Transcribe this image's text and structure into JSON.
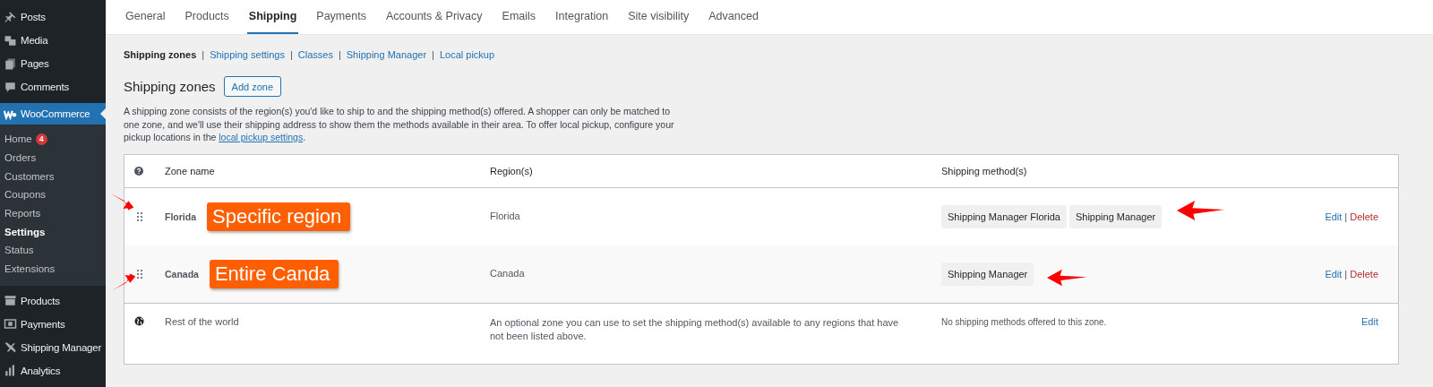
{
  "sidebar": {
    "items": [
      {
        "label": "Posts",
        "selected": false
      },
      {
        "label": "Media",
        "selected": false
      },
      {
        "label": "Pages",
        "selected": false
      },
      {
        "label": "Comments",
        "selected": false
      },
      {
        "label": "WooCommerce",
        "selected": true,
        "children": [
          {
            "label": "Home",
            "badge": "4",
            "selected": false
          },
          {
            "label": "Orders",
            "selected": false
          },
          {
            "label": "Customers",
            "selected": false
          },
          {
            "label": "Coupons",
            "selected": false
          },
          {
            "label": "Reports",
            "selected": false
          },
          {
            "label": "Settings",
            "selected": true
          },
          {
            "label": "Status",
            "selected": false
          },
          {
            "label": "Extensions",
            "selected": false
          }
        ]
      },
      {
        "label": "Products",
        "selected": false
      },
      {
        "label": "Payments",
        "selected": false
      },
      {
        "label": "Shipping Manager",
        "selected": false
      },
      {
        "label": "Analytics",
        "selected": false
      }
    ]
  },
  "tabs": [
    {
      "label": "General",
      "selected": false
    },
    {
      "label": "Products",
      "selected": false
    },
    {
      "label": "Shipping",
      "selected": true
    },
    {
      "label": "Payments",
      "selected": false
    },
    {
      "label": "Accounts & Privacy",
      "selected": false
    },
    {
      "label": "Emails",
      "selected": false
    },
    {
      "label": "Integration",
      "selected": false
    },
    {
      "label": "Site visibility",
      "selected": false
    },
    {
      "label": "Advanced",
      "selected": false
    }
  ],
  "subnav": {
    "separator": "|",
    "items": [
      {
        "label": "Shipping zones",
        "selected": true
      },
      {
        "label": "Shipping settings",
        "selected": false
      },
      {
        "label": "Classes",
        "selected": false
      },
      {
        "label": "Shipping Manager",
        "selected": false
      },
      {
        "label": "Local pickup",
        "selected": false
      }
    ]
  },
  "heading": "Shipping zones",
  "add_button": "Add zone",
  "description": {
    "text": "A shipping zone consists of the region(s) you'd like to ship to and the shipping method(s) offered. A shopper can only be matched to one zone, and we'll use their shipping address to show them the methods available in their area. To offer local pickup, configure your pickup locations in the ",
    "link": "local pickup settings",
    "end": "."
  },
  "table": {
    "columns": [
      "Zone name",
      "Region(s)",
      "Shipping method(s)"
    ],
    "action_separator": "|",
    "rows": [
      {
        "kind": "zone",
        "name": "Florida",
        "region": "Florida",
        "methods": [
          "Shipping Manager Florida",
          "Shipping Manager"
        ],
        "actions": [
          {
            "label": "Edit",
            "kind": "edit"
          },
          {
            "label": "Delete",
            "kind": "delete"
          }
        ],
        "annotation": "Specific region"
      },
      {
        "kind": "zone",
        "name": "Canada",
        "region": "Canada",
        "methods": [
          "Shipping Manager"
        ],
        "actions": [
          {
            "label": "Edit",
            "kind": "edit"
          },
          {
            "label": "Delete",
            "kind": "delete"
          }
        ],
        "annotation": "Entire Canda"
      },
      {
        "kind": "rest",
        "name": "Rest of the world",
        "region": "An optional zone you can use to set the shipping method(s) available to any regions that have not been listed above.",
        "note": "No shipping methods offered to this zone.",
        "actions": [
          {
            "label": "Edit",
            "kind": "edit"
          }
        ]
      }
    ]
  }
}
